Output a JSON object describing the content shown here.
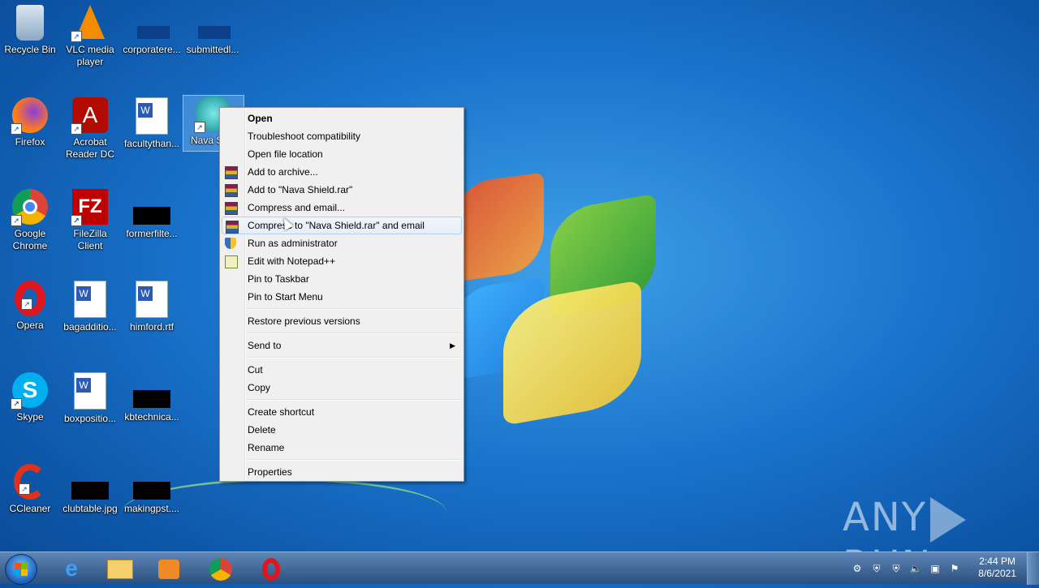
{
  "desktop": {
    "icons": [
      {
        "label": "Recycle Bin",
        "icon": "recycle-bin-icon"
      },
      {
        "label": "VLC media player",
        "icon": "vlc-icon"
      },
      {
        "label": "corporatere...",
        "icon": "file-icon"
      },
      {
        "label": "submittedl...",
        "icon": "file-icon"
      },
      {
        "label": "Firefox",
        "icon": "firefox-icon"
      },
      {
        "label": "Acrobat Reader DC",
        "icon": "acrobat-icon"
      },
      {
        "label": "facultythan...",
        "icon": "word-doc-icon"
      },
      {
        "label": "Nava Sh...",
        "icon": "nava-shield-icon"
      },
      {
        "label": "Google Chrome",
        "icon": "chrome-icon"
      },
      {
        "label": "FileZilla Client",
        "icon": "filezilla-icon"
      },
      {
        "label": "formerfilte...",
        "icon": "file-icon"
      },
      {
        "label": "Opera",
        "icon": "opera-icon"
      },
      {
        "label": "bagadditio...",
        "icon": "word-doc-icon"
      },
      {
        "label": "himford.rtf",
        "icon": "word-doc-icon"
      },
      {
        "label": "Skype",
        "icon": "skype-icon"
      },
      {
        "label": "boxpositio...",
        "icon": "word-doc-icon"
      },
      {
        "label": "kbtechnica...",
        "icon": "file-icon"
      },
      {
        "label": "CCleaner",
        "icon": "ccleaner-icon"
      },
      {
        "label": "clubtable.jpg",
        "icon": "image-file-icon"
      },
      {
        "label": "makingpst....",
        "icon": "file-icon"
      }
    ]
  },
  "context_menu": {
    "items": [
      {
        "label": "Open"
      },
      {
        "label": "Troubleshoot compatibility"
      },
      {
        "label": "Open file location"
      },
      {
        "label": "Add to archive..."
      },
      {
        "label": "Add to \"Nava Shield.rar\""
      },
      {
        "label": "Compress and email..."
      },
      {
        "label": "Compress to \"Nava Shield.rar\" and email"
      },
      {
        "label": "Run as administrator"
      },
      {
        "label": "Edit with Notepad++"
      },
      {
        "label": "Pin to Taskbar"
      },
      {
        "label": "Pin to Start Menu"
      },
      {
        "label": "Restore previous versions"
      },
      {
        "label": "Send to"
      },
      {
        "label": "Cut"
      },
      {
        "label": "Copy"
      },
      {
        "label": "Create shortcut"
      },
      {
        "label": "Delete"
      },
      {
        "label": "Rename"
      },
      {
        "label": "Properties"
      }
    ]
  },
  "watermark": {
    "left": "ANY",
    "right": "RUN"
  },
  "taskbar": {
    "apps": [
      "internet-explorer-icon",
      "file-explorer-icon",
      "media-player-icon",
      "chrome-icon",
      "opera-icon"
    ],
    "clock": {
      "time": "2:44 PM",
      "date": "8/6/2021"
    }
  },
  "colors": {
    "accent": "#1a74cc",
    "menu_bg": "#f0f0f0",
    "menu_hover_border": "#aecff7"
  }
}
